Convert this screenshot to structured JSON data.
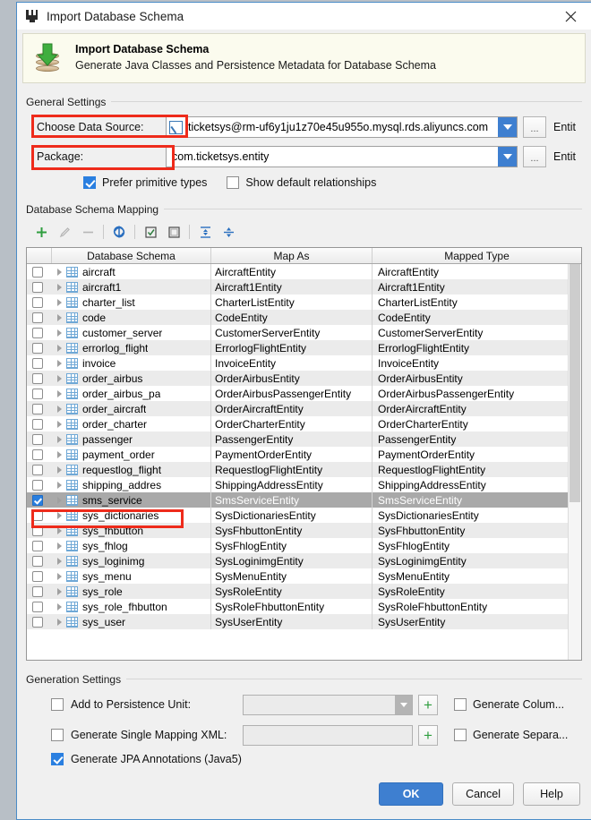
{
  "window": {
    "title": "Import Database Schema",
    "title_icon": "module-icon",
    "close_icon": "close-icon"
  },
  "banner": {
    "icon": "database-import-icon",
    "title": "Import Database Schema",
    "subtitle": "Generate Java Classes and Persistence Metadata for Database Schema"
  },
  "general_settings": {
    "legend": "General Settings",
    "data_source": {
      "label": "Choose Data Source:",
      "icon": "data-source-icon",
      "value": "ticketsys@rm-uf6y1ju1z70e45u955o.mysql.rds.aliyuncs.com",
      "dropdown_icon": "chevron-down-icon",
      "browse_label": "...",
      "trailing_label": "Entit"
    },
    "package": {
      "label": "Package:",
      "value": "com.ticketsys.entity",
      "dropdown_icon": "chevron-down-icon",
      "browse_label": "...",
      "trailing_label": "Entit"
    },
    "prefer_primitive_types": {
      "label": "Prefer primitive types",
      "checked": true
    },
    "show_default_relationships": {
      "label": "Show default relationships",
      "checked": false
    }
  },
  "mapping": {
    "legend": "Database Schema Mapping",
    "toolbar": [
      {
        "name": "add-button",
        "icon": "plus-icon",
        "enabled": true
      },
      {
        "name": "edit-button",
        "icon": "pencil-icon",
        "enabled": false
      },
      {
        "name": "remove-button",
        "icon": "minus-icon",
        "enabled": false
      },
      {
        "name": "refresh-button",
        "icon": "refresh-icon",
        "enabled": true
      },
      {
        "name": "select-all-button",
        "icon": "checked-box-icon",
        "enabled": true
      },
      {
        "name": "deselect-all-button",
        "icon": "empty-box-icon",
        "enabled": true
      },
      {
        "name": "expand-all-button",
        "icon": "expand-all-icon",
        "enabled": true
      },
      {
        "name": "collapse-all-button",
        "icon": "collapse-all-icon",
        "enabled": true
      }
    ],
    "columns": [
      "Database Schema",
      "Map As",
      "Mapped Type"
    ],
    "rows": [
      {
        "schema": "aircraft",
        "map_as": "AircraftEntity",
        "mapped_type": "AircraftEntity",
        "checked": false,
        "selected": false
      },
      {
        "schema": "aircraft1",
        "map_as": "Aircraft1Entity",
        "mapped_type": "Aircraft1Entity",
        "checked": false,
        "selected": false
      },
      {
        "schema": "charter_list",
        "map_as": "CharterListEntity",
        "mapped_type": "CharterListEntity",
        "checked": false,
        "selected": false
      },
      {
        "schema": "code",
        "map_as": "CodeEntity",
        "mapped_type": "CodeEntity",
        "checked": false,
        "selected": false
      },
      {
        "schema": "customer_server",
        "map_as": "CustomerServerEntity",
        "mapped_type": "CustomerServerEntity",
        "checked": false,
        "selected": false
      },
      {
        "schema": "errorlog_flight",
        "map_as": "ErrorlogFlightEntity",
        "mapped_type": "ErrorlogFlightEntity",
        "checked": false,
        "selected": false
      },
      {
        "schema": "invoice",
        "map_as": "InvoiceEntity",
        "mapped_type": "InvoiceEntity",
        "checked": false,
        "selected": false
      },
      {
        "schema": "order_airbus",
        "map_as": "OrderAirbusEntity",
        "mapped_type": "OrderAirbusEntity",
        "checked": false,
        "selected": false
      },
      {
        "schema": "order_airbus_pa",
        "map_as": "OrderAirbusPassengerEntity",
        "mapped_type": "OrderAirbusPassengerEntity",
        "checked": false,
        "selected": false
      },
      {
        "schema": "order_aircraft",
        "map_as": "OrderAircraftEntity",
        "mapped_type": "OrderAircraftEntity",
        "checked": false,
        "selected": false
      },
      {
        "schema": "order_charter",
        "map_as": "OrderCharterEntity",
        "mapped_type": "OrderCharterEntity",
        "checked": false,
        "selected": false
      },
      {
        "schema": "passenger",
        "map_as": "PassengerEntity",
        "mapped_type": "PassengerEntity",
        "checked": false,
        "selected": false
      },
      {
        "schema": "payment_order",
        "map_as": "PaymentOrderEntity",
        "mapped_type": "PaymentOrderEntity",
        "checked": false,
        "selected": false
      },
      {
        "schema": "requestlog_flight",
        "map_as": "RequestlogFlightEntity",
        "mapped_type": "RequestlogFlightEntity",
        "checked": false,
        "selected": false
      },
      {
        "schema": "shipping_addres",
        "map_as": "ShippingAddressEntity",
        "mapped_type": "ShippingAddressEntity",
        "checked": false,
        "selected": false
      },
      {
        "schema": "sms_service",
        "map_as": "SmsServiceEntity",
        "mapped_type": "SmsServiceEntity",
        "checked": true,
        "selected": true
      },
      {
        "schema": "sys_dictionaries",
        "map_as": "SysDictionariesEntity",
        "mapped_type": "SysDictionariesEntity",
        "checked": false,
        "selected": false
      },
      {
        "schema": "sys_fhbutton",
        "map_as": "SysFhbuttonEntity",
        "mapped_type": "SysFhbuttonEntity",
        "checked": false,
        "selected": false
      },
      {
        "schema": "sys_fhlog",
        "map_as": "SysFhlogEntity",
        "mapped_type": "SysFhlogEntity",
        "checked": false,
        "selected": false
      },
      {
        "schema": "sys_loginimg",
        "map_as": "SysLoginimgEntity",
        "mapped_type": "SysLoginimgEntity",
        "checked": false,
        "selected": false
      },
      {
        "schema": "sys_menu",
        "map_as": "SysMenuEntity",
        "mapped_type": "SysMenuEntity",
        "checked": false,
        "selected": false
      },
      {
        "schema": "sys_role",
        "map_as": "SysRoleEntity",
        "mapped_type": "SysRoleEntity",
        "checked": false,
        "selected": false
      },
      {
        "schema": "sys_role_fhbutton",
        "map_as": "SysRoleFhbuttonEntity",
        "mapped_type": "SysRoleFhbuttonEntity",
        "checked": false,
        "selected": false
      },
      {
        "schema": "sys_user",
        "map_as": "SysUserEntity",
        "mapped_type": "SysUserEntity",
        "checked": false,
        "selected": false
      }
    ]
  },
  "generation_settings": {
    "legend": "Generation Settings",
    "add_to_persistence_unit": {
      "label": "Add to Persistence Unit:",
      "checked": false,
      "value": ""
    },
    "generate_single_mapping_xml": {
      "label": "Generate Single Mapping XML:",
      "checked": false,
      "value": ""
    },
    "generate_jpa_annotations": {
      "label": "Generate JPA Annotations (Java5)",
      "checked": true
    },
    "generate_column": {
      "label": "Generate Colum...",
      "checked": false
    },
    "generate_separate": {
      "label": "Generate Separa...",
      "checked": false
    },
    "add_button_label": "+"
  },
  "footer": {
    "ok": "OK",
    "cancel": "Cancel",
    "help": "Help"
  },
  "accent_colors": {
    "primary_blue": "#3e7fd0",
    "annotation_red": "#ee2b1b",
    "selection_gray": "#a9a9a9",
    "banner_bg": "#fbfbee"
  }
}
